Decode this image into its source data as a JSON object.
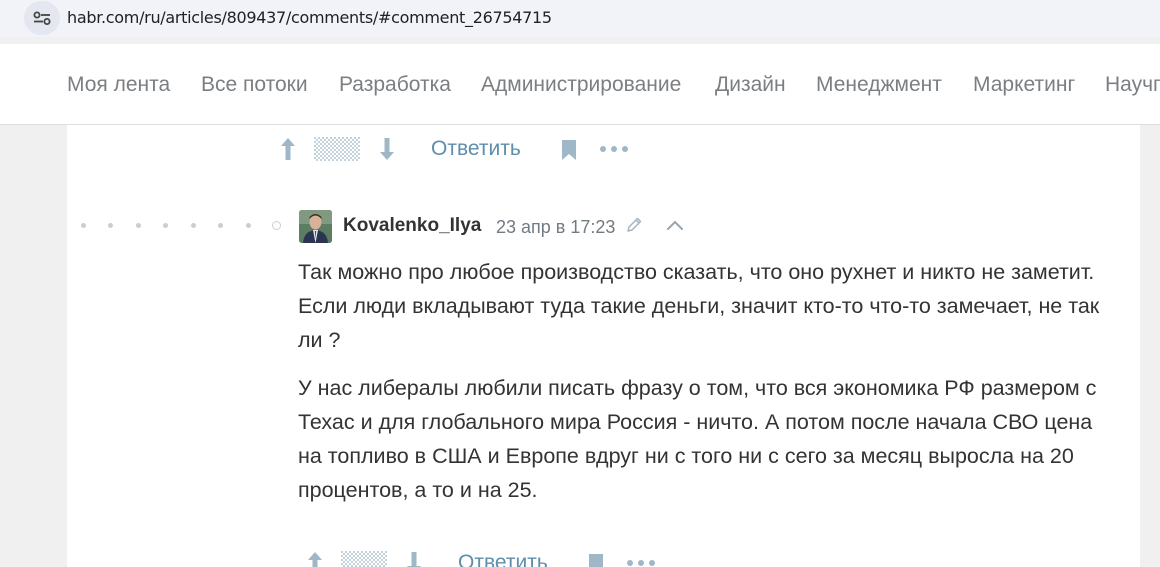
{
  "browser": {
    "url": "habr.com/ru/articles/809437/comments/#comment_26754715",
    "site_info_icon": "tune-icon"
  },
  "nav": {
    "items": [
      "Моя лента",
      "Все потоки",
      "Разработка",
      "Администрирование",
      "Дизайн",
      "Менеджмент",
      "Маркетинг",
      "Научпоп"
    ]
  },
  "prev_actions": {
    "reply_label": "Ответить"
  },
  "comment": {
    "author": "Kovalenko_Ilya",
    "timestamp": "23 апр в 17:23",
    "paragraphs": [
      "Так можно про любое производство сказать, что оно рухнет и никто не заметит. Если люди вкладывают туда такие деньги, значит кто-то что-то замечает, не так ли ?",
      "У нас либералы любили писать фразу о том, что вся экономика РФ размером с Техас и для глобального мира Россия - ничто. А потом после начала СВО цена на топливо в США и Европе вдруг ни с того ни с сего за месяц выросла на 20 процентов, а то и на 25."
    ]
  },
  "next_actions": {
    "reply_label": "Ответить"
  },
  "colors": {
    "link": "#5e8eac",
    "nav_text": "#7b7f82",
    "icon": "#9fb7c7",
    "background": "#f0f0f0"
  }
}
